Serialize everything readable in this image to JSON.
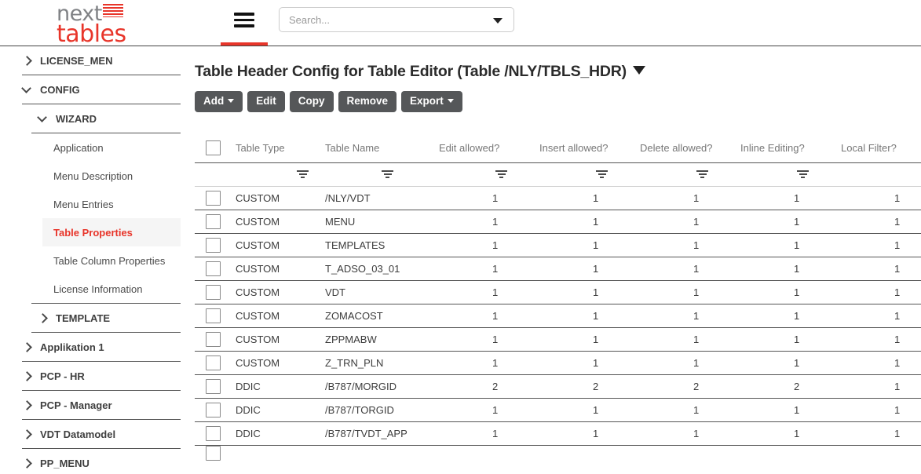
{
  "header": {
    "logo_top": "next",
    "logo_bottom": "tables",
    "logo_grid_icon": "grid-icon",
    "menu_icon": "hamburger-menu-icon",
    "search": {
      "value": "",
      "placeholder": "Search...",
      "dropdown_icon": "chevron-down-icon"
    }
  },
  "sidebar": {
    "items": [
      {
        "label": "LICENSE_MEN",
        "level": 0,
        "type": "group",
        "expanded": false,
        "name": "sidebar-item-license-men"
      },
      {
        "label": "CONFIG",
        "level": 0,
        "type": "group",
        "expanded": true,
        "name": "sidebar-item-config"
      },
      {
        "label": "WIZARD",
        "level": 1,
        "type": "group",
        "expanded": true,
        "name": "sidebar-item-wizard"
      },
      {
        "label": "Application",
        "level": 2,
        "type": "leaf",
        "active": false,
        "name": "sidebar-item-application"
      },
      {
        "label": "Menu Description",
        "level": 2,
        "type": "leaf",
        "active": false,
        "name": "sidebar-item-menu-description"
      },
      {
        "label": "Menu Entries",
        "level": 2,
        "type": "leaf",
        "active": false,
        "name": "sidebar-item-menu-entries"
      },
      {
        "label": "Table Properties",
        "level": 2,
        "type": "leaf",
        "active": true,
        "name": "sidebar-item-table-properties"
      },
      {
        "label": "Table Column Properties",
        "level": 2,
        "type": "leaf",
        "active": false,
        "name": "sidebar-item-table-column-properties"
      },
      {
        "label": "License Information",
        "level": 2,
        "type": "leaf",
        "active": false,
        "name": "sidebar-item-license-information"
      },
      {
        "label": "TEMPLATE",
        "level": 1,
        "type": "group",
        "expanded": false,
        "name": "sidebar-item-template"
      },
      {
        "label": "Applikation 1",
        "level": 0,
        "type": "group",
        "expanded": false,
        "name": "sidebar-item-applikation-1"
      },
      {
        "label": "PCP - HR",
        "level": 0,
        "type": "group",
        "expanded": false,
        "name": "sidebar-item-pcp-hr"
      },
      {
        "label": "PCP - Manager",
        "level": 0,
        "type": "group",
        "expanded": false,
        "name": "sidebar-item-pcp-manager"
      },
      {
        "label": "VDT Datamodel",
        "level": 0,
        "type": "group",
        "expanded": false,
        "name": "sidebar-item-vdt-datamodel"
      },
      {
        "label": "PP_MENU",
        "level": 0,
        "type": "group",
        "expanded": false,
        "name": "sidebar-item-pp-menu"
      }
    ]
  },
  "main": {
    "title": "Table Header Config for Table Editor (Table /NLY/TBLS_HDR)",
    "title_caret_icon": "caret-down-icon",
    "toolbar": [
      {
        "label": "Add",
        "caret": true,
        "name": "add-button"
      },
      {
        "label": "Edit",
        "caret": false,
        "name": "edit-button"
      },
      {
        "label": "Copy",
        "caret": false,
        "name": "copy-button"
      },
      {
        "label": "Remove",
        "caret": false,
        "name": "remove-button"
      },
      {
        "label": "Export",
        "caret": true,
        "name": "export-button"
      }
    ],
    "table": {
      "columns": [
        "Table Type",
        "Table Name",
        "Edit allowed?",
        "Insert allowed?",
        "Delete allowed?",
        "Inline Editing?",
        "Local Filter?"
      ],
      "filter_icon": "filter-icon",
      "select_all_checkbox": false,
      "rows": [
        {
          "checked": false,
          "cells": [
            "CUSTOM",
            "/NLY/VDT",
            "1",
            "1",
            "1",
            "1",
            "1"
          ]
        },
        {
          "checked": false,
          "cells": [
            "CUSTOM",
            "MENU",
            "1",
            "1",
            "1",
            "1",
            "1"
          ]
        },
        {
          "checked": false,
          "cells": [
            "CUSTOM",
            "TEMPLATES",
            "1",
            "1",
            "1",
            "1",
            "1"
          ]
        },
        {
          "checked": false,
          "cells": [
            "CUSTOM",
            "T_ADSO_03_01",
            "1",
            "1",
            "1",
            "1",
            "1"
          ]
        },
        {
          "checked": false,
          "cells": [
            "CUSTOM",
            "VDT",
            "1",
            "1",
            "1",
            "1",
            "1"
          ]
        },
        {
          "checked": false,
          "cells": [
            "CUSTOM",
            "ZOMACOST",
            "1",
            "1",
            "1",
            "1",
            "1"
          ]
        },
        {
          "checked": false,
          "cells": [
            "CUSTOM",
            "ZPPMABW",
            "1",
            "1",
            "1",
            "1",
            "1"
          ]
        },
        {
          "checked": false,
          "cells": [
            "CUSTOM",
            "Z_TRN_PLN",
            "1",
            "1",
            "1",
            "1",
            "1"
          ]
        },
        {
          "checked": false,
          "cells": [
            "DDIC",
            "/B787/MORGID",
            "2",
            "2",
            "2",
            "2",
            "1"
          ]
        },
        {
          "checked": false,
          "cells": [
            "DDIC",
            "/B787/TORGID",
            "1",
            "1",
            "1",
            "1",
            "1"
          ]
        },
        {
          "checked": false,
          "cells": [
            "DDIC",
            "/B787/TVDT_APP",
            "1",
            "1",
            "1",
            "1",
            "1"
          ]
        }
      ]
    }
  },
  "colors": {
    "accent": "#e8352a",
    "logo_gray": "#808285",
    "button": "#555759",
    "active_row_bg": "#f5f5f5"
  }
}
